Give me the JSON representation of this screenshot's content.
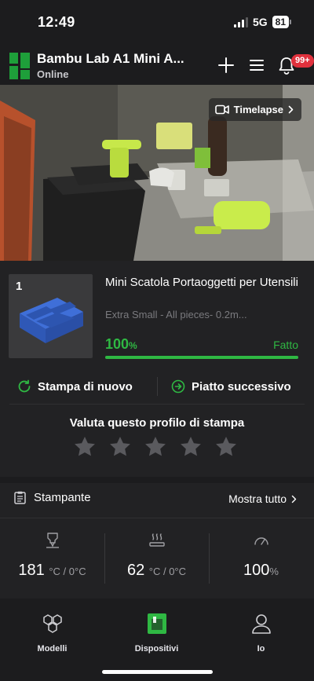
{
  "status_bar": {
    "time": "12:49",
    "network": "5G",
    "battery": "81"
  },
  "header": {
    "title": "Bambu Lab A1 Mini A...",
    "status": "Online",
    "notification_badge": "99+",
    "icons": {
      "add": "plus-icon",
      "menu": "menu-icon",
      "bell": "bell-icon"
    },
    "brand_color": "#1e9f3a"
  },
  "camera": {
    "timelapse_label": "Timelapse"
  },
  "job": {
    "plate_number": "1",
    "title": "Mini Scatola Portaoggetti per Utensili",
    "subtitle": "Extra Small - All pieces- 0.2m...",
    "progress_value": "100",
    "progress_unit": "%",
    "progress_fraction": 1.0,
    "state": "Fatto",
    "reprint_label": "Stampa di nuovo",
    "next_plate_label": "Piatto successivo",
    "accent_color": "#2fb843"
  },
  "rating": {
    "label": "Valuta questo profilo di stampa",
    "max_stars": 5,
    "value": 0
  },
  "printer": {
    "section_label": "Stampante",
    "show_all_label": "Mostra tutto",
    "nozzle": {
      "value": "181",
      "unit": "°C / 0°C"
    },
    "bed": {
      "value": "62",
      "unit": "°C / 0°C"
    },
    "speed": {
      "value": "100",
      "unit": "%"
    }
  },
  "tabs": [
    {
      "label": "Modelli",
      "icon": "cubes-icon",
      "active": false
    },
    {
      "label": "Dispositivi",
      "icon": "printer-device-icon",
      "active": true
    },
    {
      "label": "Io",
      "icon": "user-icon",
      "active": false
    }
  ]
}
